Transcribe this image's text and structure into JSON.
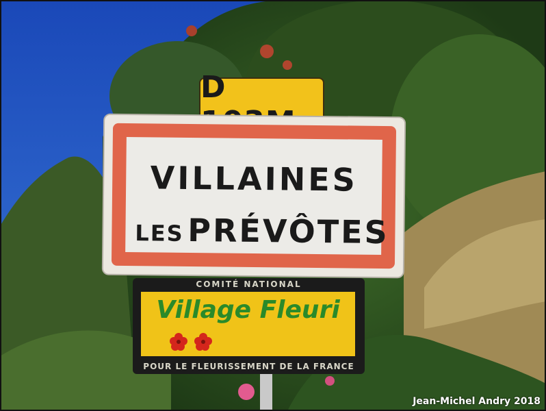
{
  "road_sign": {
    "number": "D 103M"
  },
  "town_sign": {
    "line1": "VILLAINES",
    "line2_small": "LES",
    "line2_big": "PRÉVÔTES"
  },
  "fleuri_sign": {
    "top_text": "COMITÉ NATIONAL",
    "title": "Village Fleuri",
    "bottom_text": "POUR LE FLEURISSEMENT DE LA FRANCE"
  },
  "watermark": "Jean-Michel Andry 2018",
  "colors": {
    "sky": "#1f52c4",
    "foliage": "#2f5a22",
    "sign_border": "#e0654a",
    "fleuri_yellow": "#f0c318",
    "fleuri_green": "#2a8a2a",
    "road_plate": "#f2c21b"
  }
}
